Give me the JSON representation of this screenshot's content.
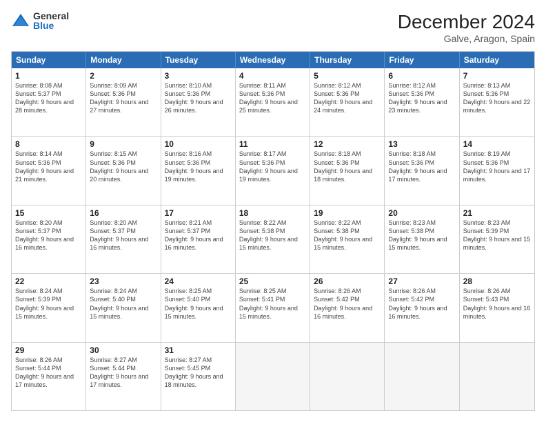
{
  "header": {
    "logo_general": "General",
    "logo_blue": "Blue",
    "month_title": "December 2024",
    "location": "Galve, Aragon, Spain"
  },
  "weekdays": [
    "Sunday",
    "Monday",
    "Tuesday",
    "Wednesday",
    "Thursday",
    "Friday",
    "Saturday"
  ],
  "rows": [
    [
      {
        "num": "1",
        "sunrise": "8:08 AM",
        "sunset": "5:37 PM",
        "daylight": "9 hours and 28 minutes."
      },
      {
        "num": "2",
        "sunrise": "8:09 AM",
        "sunset": "5:36 PM",
        "daylight": "9 hours and 27 minutes."
      },
      {
        "num": "3",
        "sunrise": "8:10 AM",
        "sunset": "5:36 PM",
        "daylight": "9 hours and 26 minutes."
      },
      {
        "num": "4",
        "sunrise": "8:11 AM",
        "sunset": "5:36 PM",
        "daylight": "9 hours and 25 minutes."
      },
      {
        "num": "5",
        "sunrise": "8:12 AM",
        "sunset": "5:36 PM",
        "daylight": "9 hours and 24 minutes."
      },
      {
        "num": "6",
        "sunrise": "8:12 AM",
        "sunset": "5:36 PM",
        "daylight": "9 hours and 23 minutes."
      },
      {
        "num": "7",
        "sunrise": "8:13 AM",
        "sunset": "5:36 PM",
        "daylight": "9 hours and 22 minutes."
      }
    ],
    [
      {
        "num": "8",
        "sunrise": "8:14 AM",
        "sunset": "5:36 PM",
        "daylight": "9 hours and 21 minutes."
      },
      {
        "num": "9",
        "sunrise": "8:15 AM",
        "sunset": "5:36 PM",
        "daylight": "9 hours and 20 minutes."
      },
      {
        "num": "10",
        "sunrise": "8:16 AM",
        "sunset": "5:36 PM",
        "daylight": "9 hours and 19 minutes."
      },
      {
        "num": "11",
        "sunrise": "8:17 AM",
        "sunset": "5:36 PM",
        "daylight": "9 hours and 19 minutes."
      },
      {
        "num": "12",
        "sunrise": "8:18 AM",
        "sunset": "5:36 PM",
        "daylight": "9 hours and 18 minutes."
      },
      {
        "num": "13",
        "sunrise": "8:18 AM",
        "sunset": "5:36 PM",
        "daylight": "9 hours and 17 minutes."
      },
      {
        "num": "14",
        "sunrise": "8:19 AM",
        "sunset": "5:36 PM",
        "daylight": "9 hours and 17 minutes."
      }
    ],
    [
      {
        "num": "15",
        "sunrise": "8:20 AM",
        "sunset": "5:37 PM",
        "daylight": "9 hours and 16 minutes."
      },
      {
        "num": "16",
        "sunrise": "8:20 AM",
        "sunset": "5:37 PM",
        "daylight": "9 hours and 16 minutes."
      },
      {
        "num": "17",
        "sunrise": "8:21 AM",
        "sunset": "5:37 PM",
        "daylight": "9 hours and 16 minutes."
      },
      {
        "num": "18",
        "sunrise": "8:22 AM",
        "sunset": "5:38 PM",
        "daylight": "9 hours and 15 minutes."
      },
      {
        "num": "19",
        "sunrise": "8:22 AM",
        "sunset": "5:38 PM",
        "daylight": "9 hours and 15 minutes."
      },
      {
        "num": "20",
        "sunrise": "8:23 AM",
        "sunset": "5:38 PM",
        "daylight": "9 hours and 15 minutes."
      },
      {
        "num": "21",
        "sunrise": "8:23 AM",
        "sunset": "5:39 PM",
        "daylight": "9 hours and 15 minutes."
      }
    ],
    [
      {
        "num": "22",
        "sunrise": "8:24 AM",
        "sunset": "5:39 PM",
        "daylight": "9 hours and 15 minutes."
      },
      {
        "num": "23",
        "sunrise": "8:24 AM",
        "sunset": "5:40 PM",
        "daylight": "9 hours and 15 minutes."
      },
      {
        "num": "24",
        "sunrise": "8:25 AM",
        "sunset": "5:40 PM",
        "daylight": "9 hours and 15 minutes."
      },
      {
        "num": "25",
        "sunrise": "8:25 AM",
        "sunset": "5:41 PM",
        "daylight": "9 hours and 15 minutes."
      },
      {
        "num": "26",
        "sunrise": "8:26 AM",
        "sunset": "5:42 PM",
        "daylight": "9 hours and 16 minutes."
      },
      {
        "num": "27",
        "sunrise": "8:26 AM",
        "sunset": "5:42 PM",
        "daylight": "9 hours and 16 minutes."
      },
      {
        "num": "28",
        "sunrise": "8:26 AM",
        "sunset": "5:43 PM",
        "daylight": "9 hours and 16 minutes."
      }
    ],
    [
      {
        "num": "29",
        "sunrise": "8:26 AM",
        "sunset": "5:44 PM",
        "daylight": "9 hours and 17 minutes."
      },
      {
        "num": "30",
        "sunrise": "8:27 AM",
        "sunset": "5:44 PM",
        "daylight": "9 hours and 17 minutes."
      },
      {
        "num": "31",
        "sunrise": "8:27 AM",
        "sunset": "5:45 PM",
        "daylight": "9 hours and 18 minutes."
      },
      null,
      null,
      null,
      null
    ]
  ]
}
